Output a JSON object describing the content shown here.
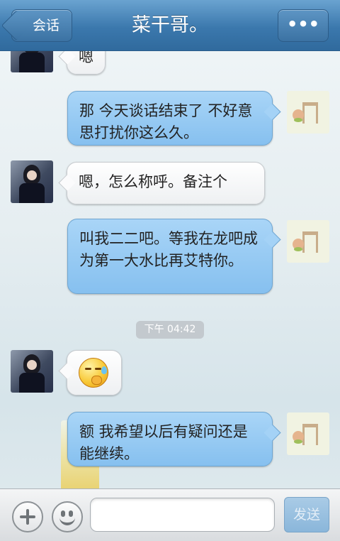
{
  "header": {
    "back_label": "会话",
    "title": "菜干哥。",
    "menu_label": "•••"
  },
  "messages": [
    {
      "side": "left",
      "text": "嗯"
    },
    {
      "side": "right",
      "text": "那 今天谈话结束了 不好意思打扰你这么久。"
    },
    {
      "side": "left",
      "text": "嗯，怎么称呼。备注个"
    },
    {
      "side": "right",
      "text": "叫我二二吧。等我在龙吧成为第一大水比再艾特你。"
    },
    {
      "side": "left",
      "type": "emoji",
      "icon": "thinking-sweat-emoji"
    },
    {
      "side": "right",
      "text": "额 我希望以后有疑问还是能继续。"
    }
  ],
  "timestamp": "下午 04:42",
  "input": {
    "placeholder": "",
    "send_label": "发送"
  },
  "colors": {
    "header_blue": "#3b78ad",
    "right_bubble": "#9ccdf4",
    "left_bubble": "#ffffff"
  }
}
